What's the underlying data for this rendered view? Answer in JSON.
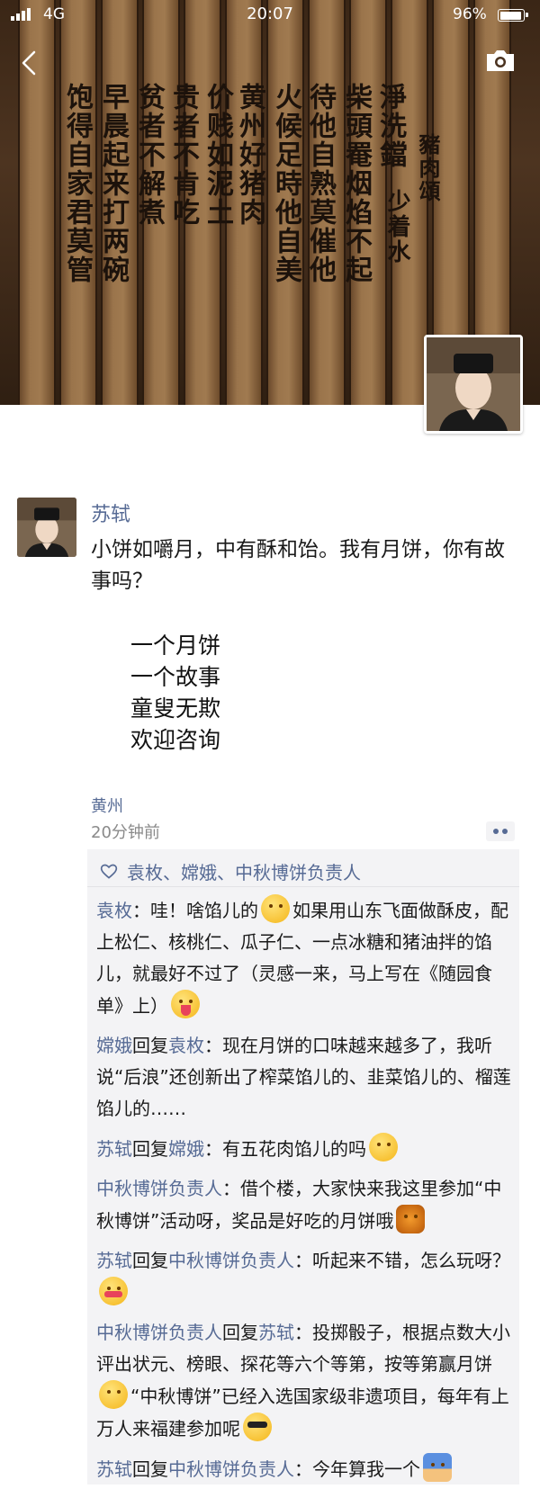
{
  "status_bar": {
    "carrier": "4G",
    "time": "20:07",
    "battery_percent": "96%"
  },
  "cover": {
    "image": "bamboo-slip-calligraphy",
    "poem_title": "豬肉頌",
    "poem_author": "少着水",
    "columns": [
      "淨洗鐺",
      "柴頭罨烟焰不起",
      "待他自熟莫催他",
      "火候足時他自美",
      "黄州好猪肉",
      "价贱如泥土",
      "贵者不肯吃",
      "贫者不解煮",
      "早晨起来打两碗",
      "饱得自家君莫管"
    ]
  },
  "post": {
    "author": "苏轼",
    "text": "小饼如嚼月，中有酥和饴。我有月饼，你有故事吗？",
    "poem_lines": [
      "一个月饼",
      "一个故事",
      "童叟无欺",
      "欢迎咨询"
    ],
    "location": "黄州",
    "time_ago": "20分钟前"
  },
  "likes": {
    "names": "袁枚、嫦娥、中秋博饼负责人"
  },
  "comments": [
    {
      "author": "袁枚",
      "reply_label": "",
      "reply_to": "",
      "text": "：哇！啥馅儿的",
      "emoji": "smile",
      "text2": "如果用山东飞面做酥皮，配上松仁、核桃仁、瓜子仁、一点冰糖和猪油拌的馅儿，就最好不过了（灵感一来，马上写在《随园食单》上）",
      "emoji2": "tongue",
      "text3": ""
    },
    {
      "author": "嫦娥",
      "reply_label": "回复",
      "reply_to": "袁枚",
      "text": "：现在月饼的口味越来越多了，我听说“后浪”还创新出了榨菜馅儿的、韭菜馅儿的、榴莲馅儿的……",
      "emoji": "",
      "text2": "",
      "emoji2": "",
      "text3": ""
    },
    {
      "author": "苏轼",
      "reply_label": "回复",
      "reply_to": "嫦娥",
      "text": "：有五花肉馅儿的吗",
      "emoji": "smirk",
      "text2": "",
      "emoji2": "",
      "text3": ""
    },
    {
      "author": "中秋博饼负责人",
      "reply_label": "",
      "reply_to": "",
      "text": "：借个楼，大家快来我这里参加“中秋博饼”活动呀，奖品是好吃的月饼哦",
      "emoji": "mooncake",
      "text2": "",
      "emoji2": "",
      "text3": ""
    },
    {
      "author": "苏轼",
      "reply_label": "回复",
      "reply_to": "中秋博饼负责人",
      "text": "：听起来不错，怎么玩呀？",
      "emoji": "cold",
      "text2": "",
      "emoji2": "",
      "text3": ""
    },
    {
      "author": "中秋博饼负责人",
      "reply_label": "回复",
      "reply_to": "苏轼",
      "text": "：投掷骰子，根据点数大小评出状元、榜眼、探花等六个等第，按等第赢月饼",
      "emoji": "thinking",
      "text2": "“中秋博饼”已经入选国家级非遗项目，每年有上万人来福建参加呢",
      "emoji2": "cool",
      "text3": ""
    },
    {
      "author": "苏轼",
      "reply_label": "回复",
      "reply_to": "中秋博饼负责人",
      "text": "：今年算我一个",
      "emoji": "hand",
      "text2": "",
      "emoji2": "",
      "text3": ""
    }
  ],
  "icons": {
    "back": "back-chevron-icon",
    "camera": "camera-icon",
    "like": "heart-outline-icon",
    "more": "more-dots-icon"
  },
  "colors": {
    "link": "#576b95",
    "panel": "#f3f3f5"
  }
}
